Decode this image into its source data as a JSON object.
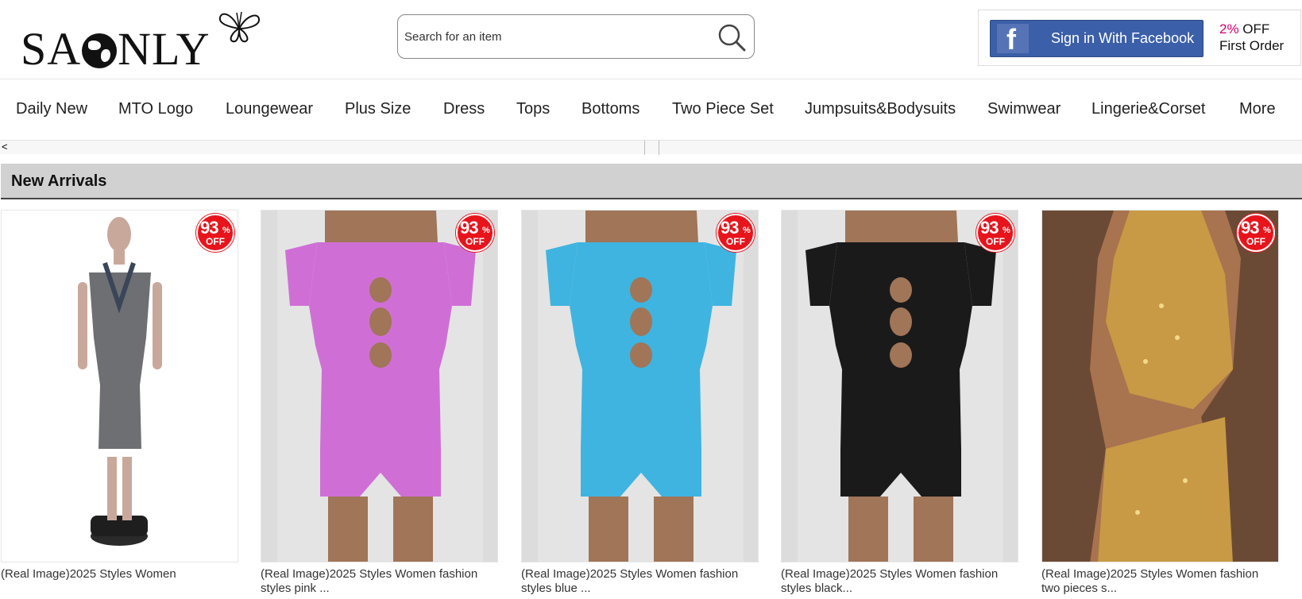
{
  "header": {
    "logo_text_left": "SA",
    "logo_text_right": "NLY",
    "search_placeholder": "Search for an item",
    "facebook_button_label": "Sign in With Facebook",
    "promo_percent": "2%",
    "promo_off": " OFF",
    "promo_line2": "First Order"
  },
  "nav": {
    "items": [
      {
        "label": "Daily New"
      },
      {
        "label": "MTO Logo"
      },
      {
        "label": "Loungewear"
      },
      {
        "label": "Plus Size"
      },
      {
        "label": "Dress"
      },
      {
        "label": "Tops"
      },
      {
        "label": "Bottoms"
      },
      {
        "label": "Two Piece Set"
      },
      {
        "label": "Jumpsuits&Bodysuits"
      },
      {
        "label": "Swimwear"
      },
      {
        "label": "Lingerie&Corset"
      },
      {
        "label": "More"
      }
    ]
  },
  "strip": {
    "arrow": "<"
  },
  "section": {
    "title": "New Arrivals"
  },
  "products": [
    {
      "title": "(Real Image)2025 Styles Women",
      "badge_num": "93",
      "badge_pct": "%",
      "badge_off": "OFF",
      "garment_color": "#6d6f73"
    },
    {
      "title": "(Real Image)2025 Styles Women fashion styles pink ...",
      "badge_num": "93",
      "badge_pct": "%",
      "badge_off": "OFF",
      "garment_color": "#cf6fd6"
    },
    {
      "title": "(Real Image)2025 Styles Women fashion styles blue ...",
      "badge_num": "93",
      "badge_pct": "%",
      "badge_off": "OFF",
      "garment_color": "#3fb4e0"
    },
    {
      "title": "(Real Image)2025 Styles Women fashion styles black...",
      "badge_num": "93",
      "badge_pct": "%",
      "badge_off": "OFF",
      "garment_color": "#1a1a1a"
    },
    {
      "title": "(Real Image)2025 Styles Women fashion two pieces s...",
      "badge_num": "93",
      "badge_pct": "%",
      "badge_off": "OFF",
      "garment_color": "#c89a45"
    }
  ],
  "colors": {
    "facebook_blue": "#3b5fa8",
    "badge_red": "#e8141c",
    "promo_pink": "#d6006d",
    "section_bar": "#d1d1d1"
  }
}
